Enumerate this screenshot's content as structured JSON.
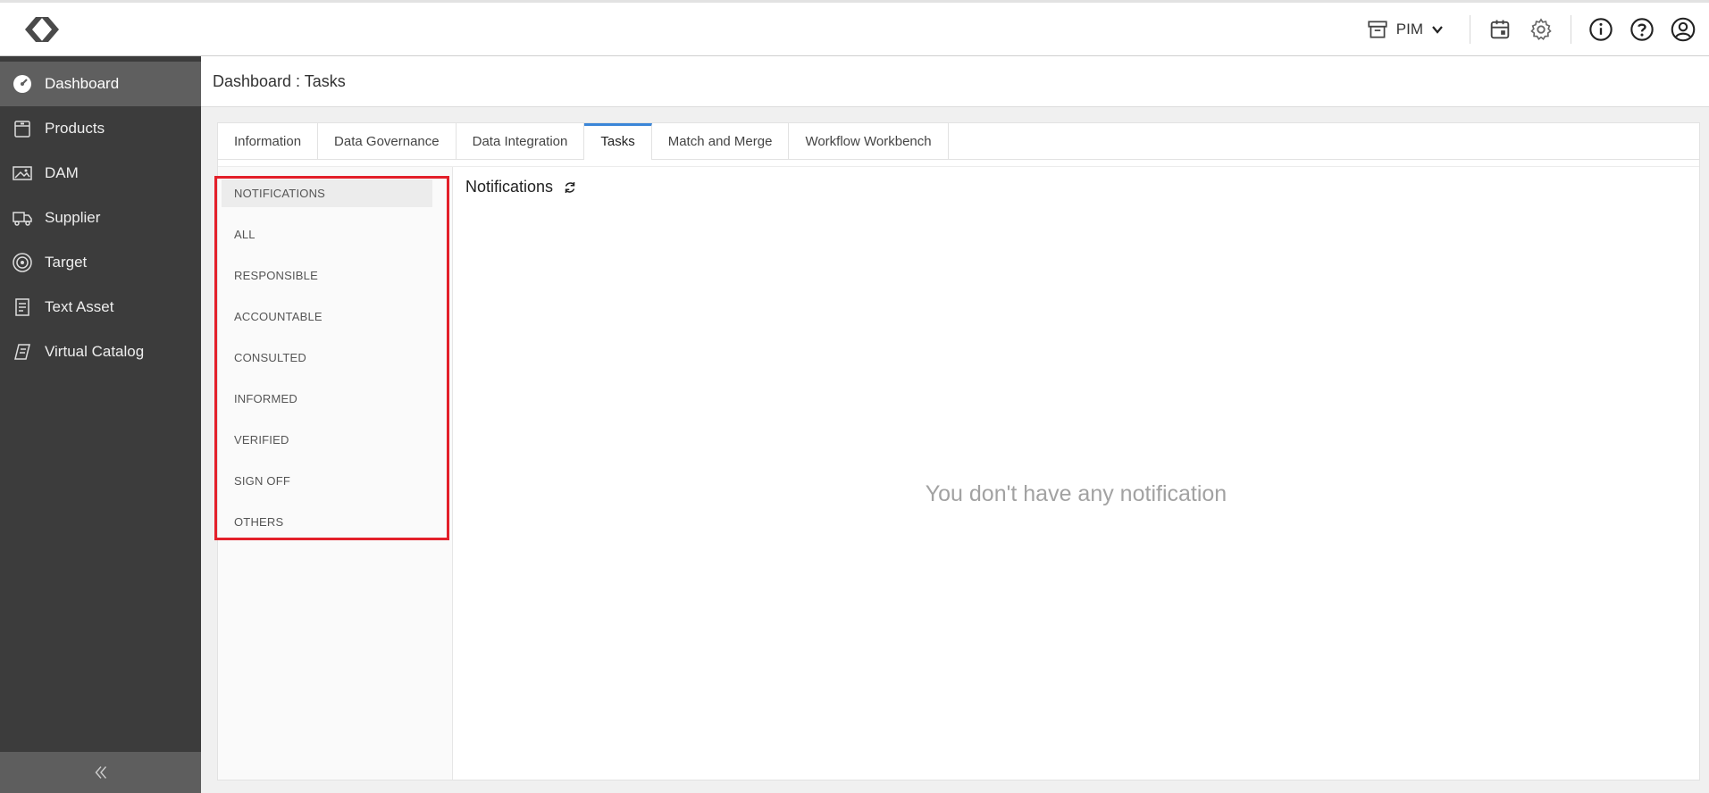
{
  "header": {
    "module": "PIM"
  },
  "sidebar": {
    "items": [
      {
        "label": "Dashboard",
        "icon": "dashboard-gauge-icon"
      },
      {
        "label": "Products",
        "icon": "box-icon"
      },
      {
        "label": "DAM",
        "icon": "image-icon"
      },
      {
        "label": "Supplier",
        "icon": "truck-icon"
      },
      {
        "label": "Target",
        "icon": "target-icon"
      },
      {
        "label": "Text Asset",
        "icon": "document-icon"
      },
      {
        "label": "Virtual Catalog",
        "icon": "catalog-icon"
      }
    ],
    "active": "Dashboard"
  },
  "page": {
    "title": "Dashboard : Tasks"
  },
  "tabs": [
    {
      "label": "Information"
    },
    {
      "label": "Data Governance"
    },
    {
      "label": "Data Integration"
    },
    {
      "label": "Tasks"
    },
    {
      "label": "Match and Merge"
    },
    {
      "label": "Workflow Workbench"
    }
  ],
  "active_tab": "Tasks",
  "filters": [
    "NOTIFICATIONS",
    "ALL",
    "RESPONSIBLE",
    "ACCOUNTABLE",
    "CONSULTED",
    "INFORMED",
    "VERIFIED",
    "SIGN OFF",
    "OTHERS"
  ],
  "active_filter": "NOTIFICATIONS",
  "notifications": {
    "title": "Notifications",
    "empty_message": "You don't have any notification"
  },
  "colors": {
    "sidebar_bg": "#3c3c3c",
    "sidebar_active": "#5f5f5f",
    "tab_accent": "#3b86d8",
    "highlight_red": "#e3202a"
  }
}
